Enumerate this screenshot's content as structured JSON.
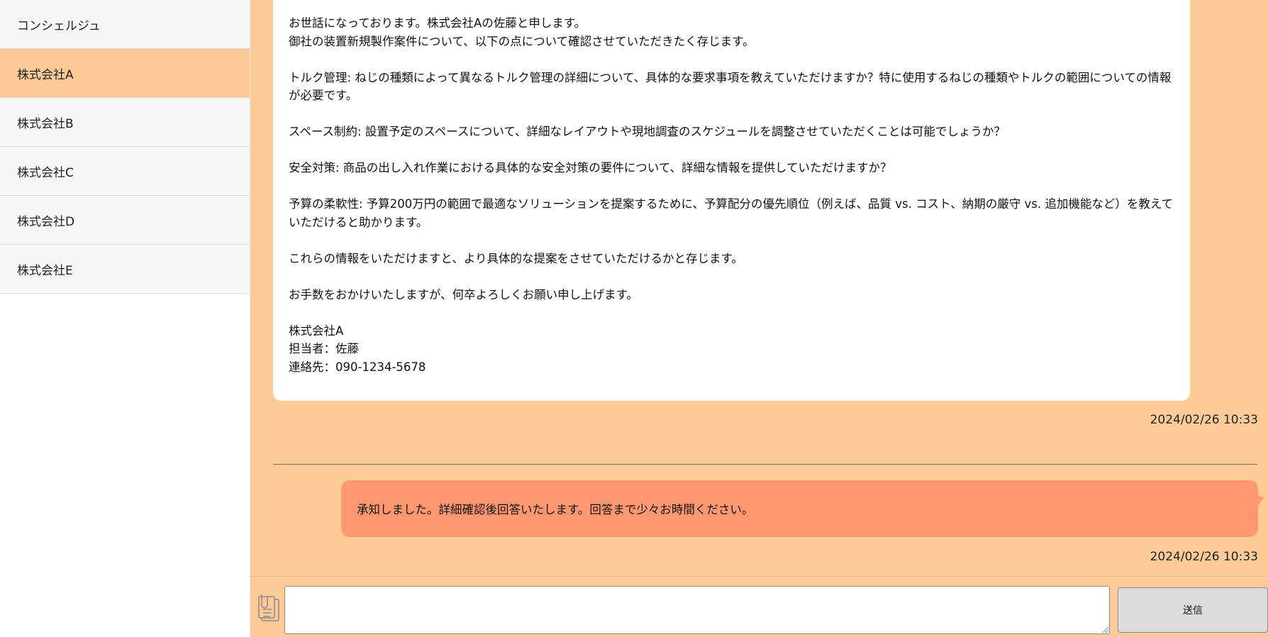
{
  "sidebar": {
    "items": [
      {
        "label": "コンシェルジュ"
      },
      {
        "label": "株式会社A"
      },
      {
        "label": "株式会社B"
      },
      {
        "label": "株式会社C"
      },
      {
        "label": "株式会社D"
      },
      {
        "label": "株式会社E"
      }
    ],
    "active_index": 1
  },
  "messages": {
    "incoming": {
      "lines": [
        "お世話になっております。株式会社Aの佐藤と申します。",
        "御社の装置新規製作案件について、以下の点について確認させていただきたく存じます。",
        "",
        "トルク管理: ねじの種類によって異なるトルク管理の詳細について、具体的な要求事項を教えていただけますか？特に使用するねじの種類やトルクの範囲についての情報が必要です。",
        "",
        "スペース制約: 設置予定のスペースについて、詳細なレイアウトや現地調査のスケジュールを調整させていただくことは可能でしょうか？",
        "",
        "安全対策: 商品の出し入れ作業における具体的な安全対策の要件について、詳細な情報を提供していただけますか？",
        "",
        "予算の柔軟性: 予算200万円の範囲で最適なソリューションを提案するために、予算配分の優先順位（例えば、品質 vs. コスト、納期の厳守 vs. 追加機能など）を教えていただけると助かります。",
        "",
        "これらの情報をいただけますと、より具体的な提案をさせていただけるかと存じます。",
        "",
        "お手数をおかけいたしますが、何卒よろしくお願い申し上げます。",
        "",
        "株式会社A",
        "担当者：佐藤",
        "連絡先：090-1234-5678"
      ],
      "timestamp": "2024/02/26 10:33"
    },
    "outgoing": {
      "text": "承知しました。詳細確認後回答いたします。回答まで少々お時間ください。",
      "timestamp": "2024/02/26 10:33"
    }
  },
  "composer": {
    "input_value": "",
    "send_label": "送信",
    "attach_icon": "clipboard-attach-icon"
  },
  "colors": {
    "main_bg": "#fdcb98",
    "active_item": "#fdca97",
    "outgoing_bubble": "#ff9870",
    "incoming_bubble": "#ffffff"
  }
}
